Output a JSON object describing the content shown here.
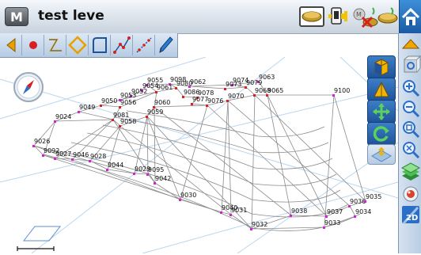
{
  "titlebar": {
    "menu_label": "M",
    "title": "test leve"
  },
  "points": [
    {
      "id": "9055"
    },
    {
      "id": "9098"
    },
    {
      "id": "9062"
    },
    {
      "id": "9074"
    },
    {
      "id": "9063"
    },
    {
      "id": "9054"
    },
    {
      "id": "9061"
    },
    {
      "id": "9080"
    },
    {
      "id": "9073"
    },
    {
      "id": "9079"
    },
    {
      "id": "9052"
    },
    {
      "id": "9086"
    },
    {
      "id": "9078"
    },
    {
      "id": "9068"
    },
    {
      "id": "9065"
    },
    {
      "id": "9053"
    },
    {
      "id": "9077"
    },
    {
      "id": "9070"
    },
    {
      "id": "9100"
    },
    {
      "id": "9050"
    },
    {
      "id": "9056"
    },
    {
      "id": "9060"
    },
    {
      "id": "9076"
    },
    {
      "id": "9049"
    },
    {
      "id": "9059"
    },
    {
      "id": "9081"
    },
    {
      "id": "9024"
    },
    {
      "id": "9058"
    },
    {
      "id": "9026"
    },
    {
      "id": "9092"
    },
    {
      "id": "9027"
    },
    {
      "id": "9046"
    },
    {
      "id": "9028"
    },
    {
      "id": "9044"
    },
    {
      "id": "9029"
    },
    {
      "id": "9095"
    },
    {
      "id": "9042"
    },
    {
      "id": "9030"
    },
    {
      "id": "9040"
    },
    {
      "id": "9031"
    },
    {
      "id": "9038"
    },
    {
      "id": "9037"
    },
    {
      "id": "9036"
    },
    {
      "id": "9035"
    },
    {
      "id": "9034"
    },
    {
      "id": "9033"
    },
    {
      "id": "9032"
    }
  ],
  "colors": {
    "point_marker": "#d61fd6",
    "point_red": "#e02020",
    "mesh": "#8a8a8a",
    "grid": "#b9d6ef",
    "toolbar_blue": "#1f5298"
  },
  "icons": {
    "toolbar": [
      "back-arrow-icon",
      "record-point-icon",
      "polyline-icon",
      "polygon-icon",
      "area-icon",
      "line-points-icon",
      "dotted-line-icon",
      "pen-icon"
    ],
    "status": [
      "memory-disk-icon",
      "gps-status-icon",
      "no-tracking-icon",
      "storage-disk-icon",
      "home-icon"
    ],
    "right": [
      "collapse-up-icon",
      "rotate-3d-icon",
      "zoom-in-icon",
      "zoom-out-icon",
      "zoom-window-icon",
      "zoom-extent-icon",
      "layers-icon",
      "locate-icon",
      "view-2d-icon"
    ],
    "left": [
      "view-box-icon",
      "tin-surface-icon",
      "pan-icon",
      "refresh-icon",
      "elevation-icon"
    ]
  },
  "view_mode_label": "2D"
}
